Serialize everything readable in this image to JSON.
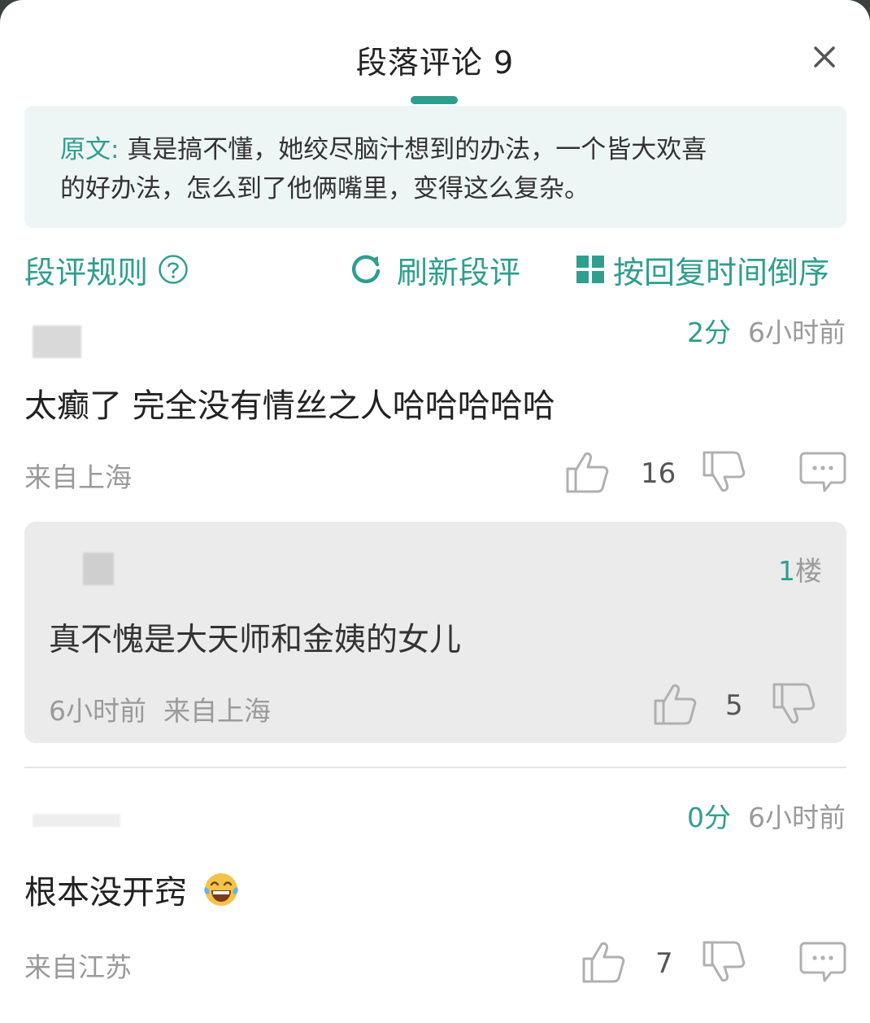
{
  "header": {
    "title": "段落评论 9"
  },
  "original": {
    "label": "原文:",
    "line1": "真是搞不懂，她绞尽脑汁想到的办法，一个皆大欢喜",
    "line2": "的好办法，怎么到了他俩嘴里，变得这么复杂。"
  },
  "toolbar": {
    "rules_label": "段评规则",
    "refresh_label": "刷新段评",
    "sort_label": "按回复时间倒序"
  },
  "comments": [
    {
      "score": "2分",
      "time": "6小时前",
      "text": "太癫了 完全没有情丝之人哈哈哈哈哈",
      "location": "来自上海",
      "likes": "16",
      "reply": {
        "floor": "1楼",
        "floor_num": "1",
        "floor_suffix": "楼",
        "text": "真不愧是大天师和金姨的女儿",
        "time": "6小时前",
        "location": "来自上海",
        "likes": "5"
      }
    },
    {
      "score": "0分",
      "time": "6小时前",
      "text": "根本没开窍",
      "emoji": "grinning-tears-emoji",
      "location": "来自江苏",
      "likes": "7"
    }
  ],
  "colors": {
    "accent": "#2f9e8e",
    "muted": "#9a9a9a",
    "reply_bg": "#ebebeb"
  },
  "icons": [
    "close-icon",
    "help-icon",
    "refresh-icon",
    "grid-icon",
    "thumbs-up-icon",
    "thumbs-down-icon",
    "comment-icon"
  ]
}
